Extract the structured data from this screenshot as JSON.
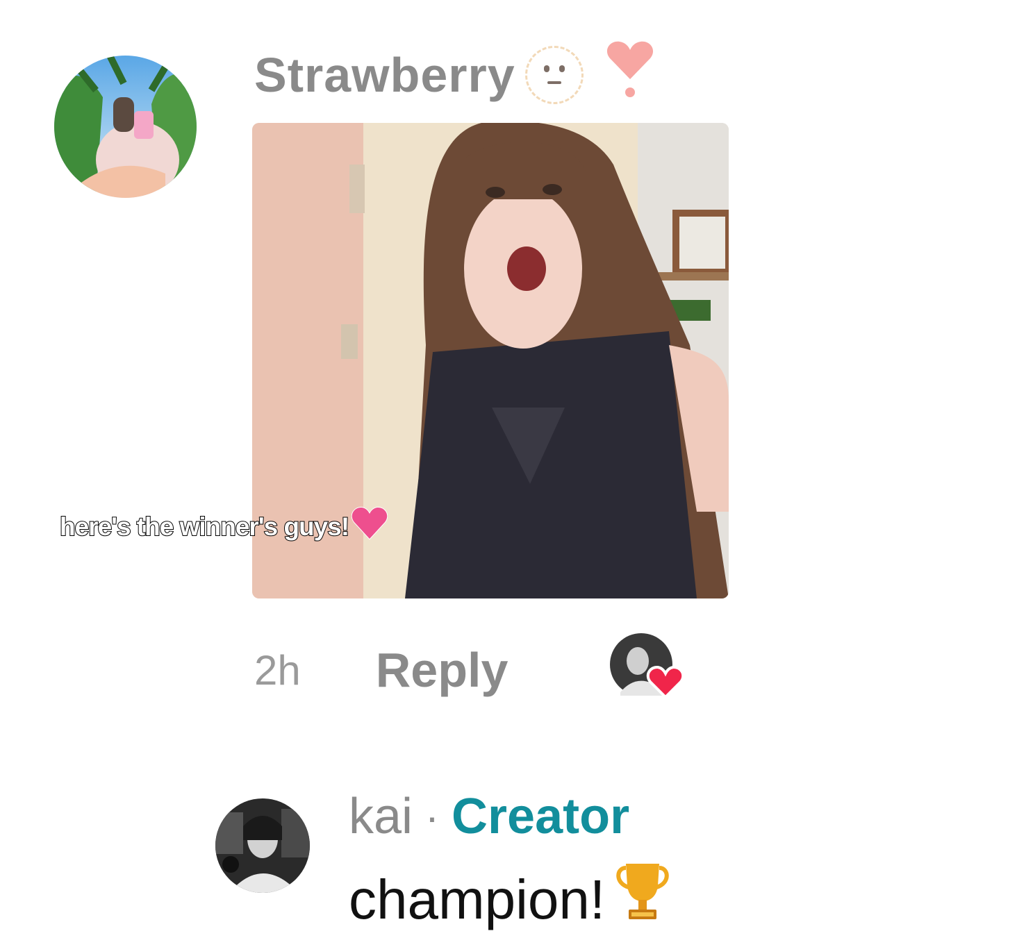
{
  "comment": {
    "username": "Strawberry",
    "emoji_icons": [
      "dotted-neutral-face-icon",
      "heart-exclamation-icon"
    ],
    "caption": "here's the winner's guys!",
    "time": "2h",
    "reply_label": "Reply",
    "liked_by_creator": true
  },
  "reply": {
    "username": "kai",
    "separator": "·",
    "badge": "Creator",
    "text": "champion!",
    "emoji_icon": "trophy-icon"
  },
  "colors": {
    "muted_text": "#8a8a8a",
    "creator_badge": "#128e9c",
    "like_heart": "#f0254a"
  }
}
